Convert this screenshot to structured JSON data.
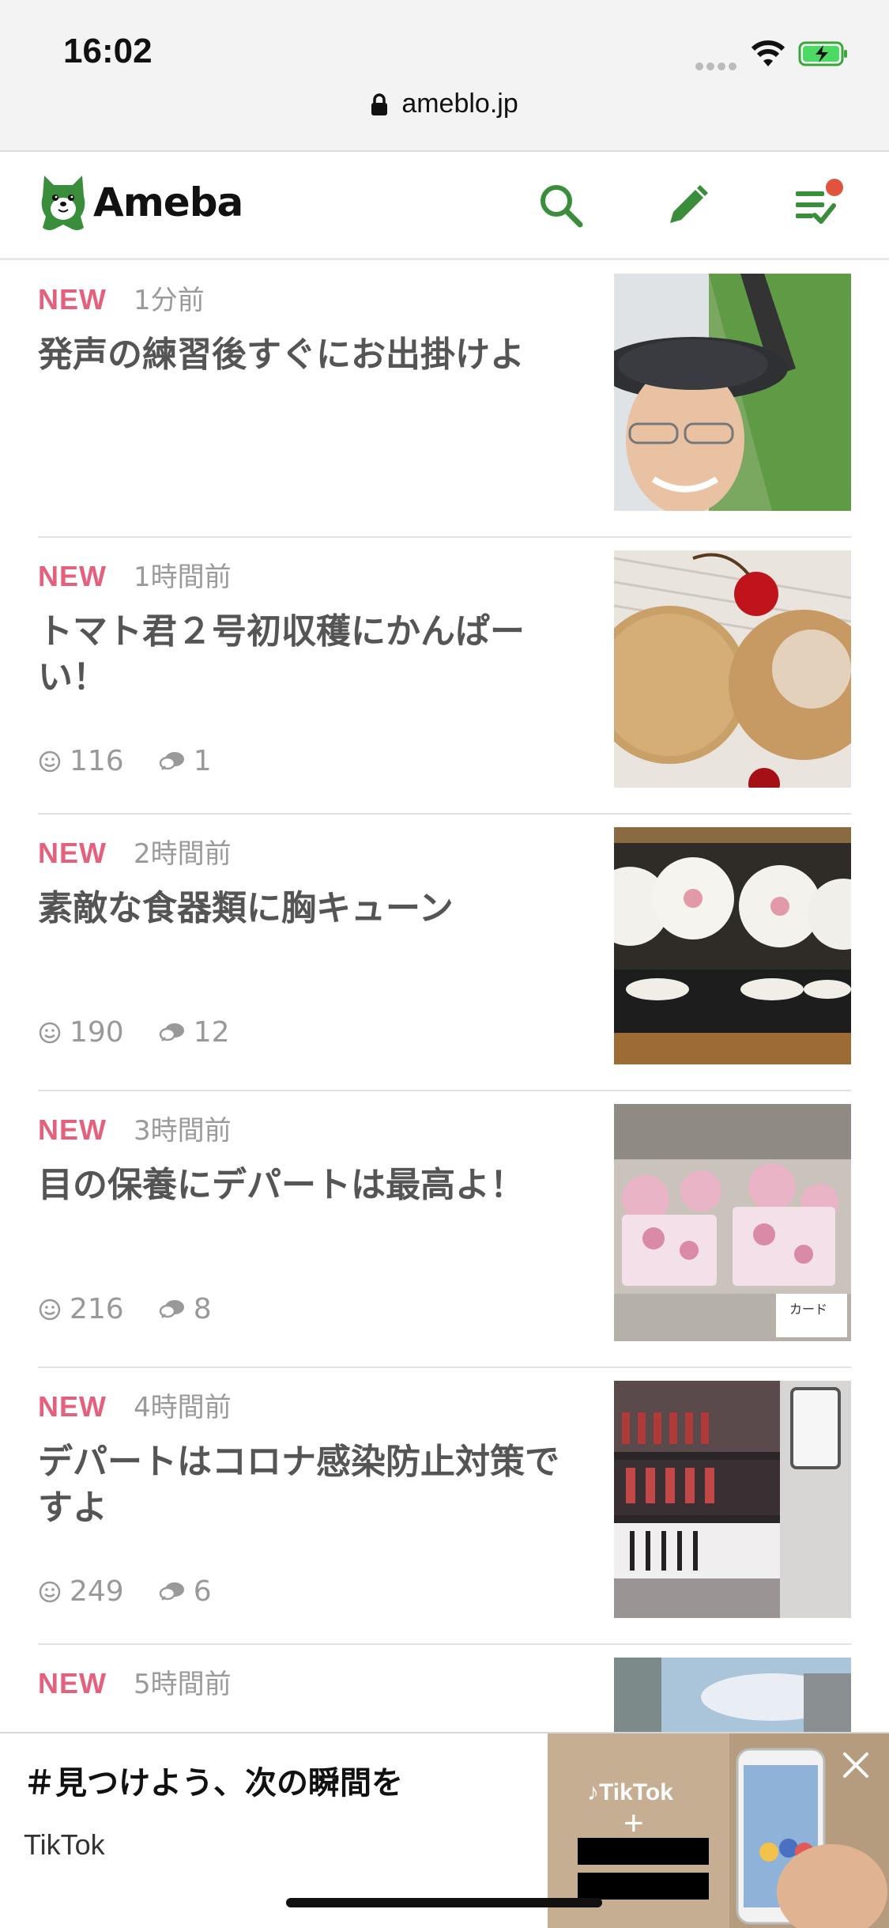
{
  "status": {
    "time": "16:02",
    "url": "ameblo.jp"
  },
  "app": {
    "logo_text": "Ameba"
  },
  "colors": {
    "brand_green": "#3a8d3a",
    "new_pink": "#e4607d",
    "notification": "#e0533d"
  },
  "icons": {
    "search": "search-icon",
    "write": "pencil-icon",
    "feed": "feed-list-icon",
    "like": "smiley-icon",
    "comment": "comment-icon"
  },
  "posts": [
    {
      "new_label": "NEW",
      "ago": "1分前",
      "title": "発声の練習後すぐにお出掛けよ",
      "likes": "",
      "comments": ""
    },
    {
      "new_label": "NEW",
      "ago": "1時間前",
      "title": "トマト君２号初収穫にかんぱーい！",
      "likes": "116",
      "comments": "1"
    },
    {
      "new_label": "NEW",
      "ago": "2時間前",
      "title": "素敵な食器類に胸キューン",
      "likes": "190",
      "comments": "12"
    },
    {
      "new_label": "NEW",
      "ago": "3時間前",
      "title": "目の保養にデパートは最高よ！",
      "likes": "216",
      "comments": "8"
    },
    {
      "new_label": "NEW",
      "ago": "4時間前",
      "title": "デパートはコロナ感染防止対策ですよ",
      "likes": "249",
      "comments": "6"
    },
    {
      "new_label": "NEW",
      "ago": "5時間前",
      "title": "",
      "likes": "",
      "comments": ""
    }
  ],
  "ad": {
    "title": "＃見つけよう、次の瞬間を",
    "advertiser": "TikTok",
    "image_text": "TikTok"
  }
}
